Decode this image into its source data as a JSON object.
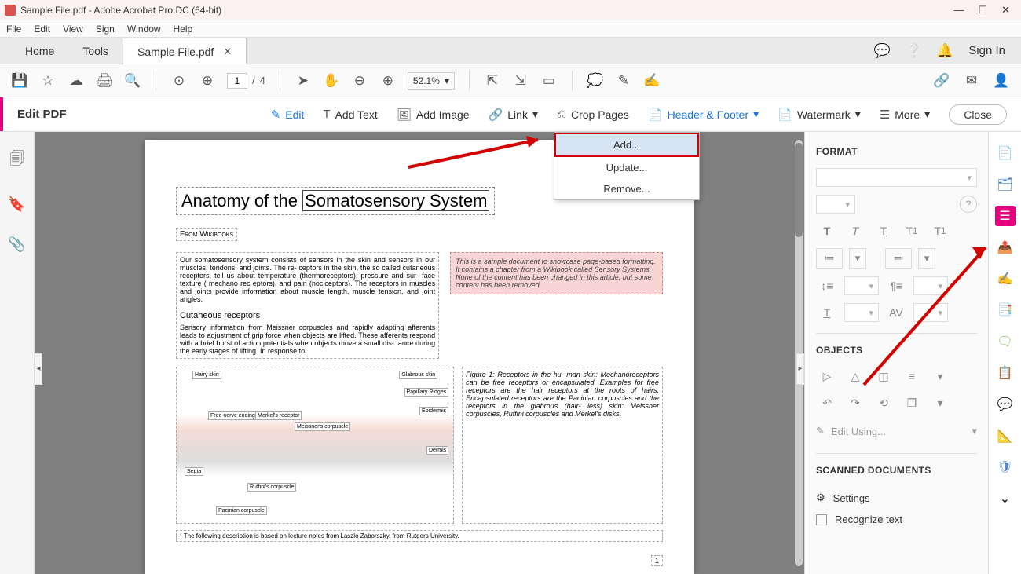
{
  "titlebar": {
    "title": "Sample File.pdf - Adobe Acrobat Pro DC (64-bit)"
  },
  "menubar": {
    "items": [
      "File",
      "Edit",
      "View",
      "Sign",
      "Window",
      "Help"
    ]
  },
  "maintabs": {
    "home": "Home",
    "tools": "Tools",
    "active_tab": "Sample File.pdf",
    "signin": "Sign In"
  },
  "toolbar": {
    "page_current": "1",
    "page_total": "4",
    "zoom": "52.1%"
  },
  "edit_toolbar": {
    "label": "Edit PDF",
    "edit": "Edit",
    "add_text": "Add Text",
    "add_image": "Add Image",
    "link": "Link",
    "crop_pages": "Crop Pages",
    "header_footer": "Header & Footer",
    "watermark": "Watermark",
    "more": "More",
    "close": "Close"
  },
  "dropdown": {
    "add": "Add...",
    "update": "Update...",
    "remove": "Remove..."
  },
  "document": {
    "title_prefix": "Anatomy of the ",
    "title_selected": "Somatosensory System",
    "from": "From Wikibooks",
    "body1": "Our somatosensory system consists of sensors in the skin and sensors in our muscles, tendons, and joints. The re- ceptors in the skin, the so called cutaneous receptors, tell us about temperature (thermoreceptors), pressure and sur- face texture ( mechano rec eptors), and pain (nociceptors). The receptors in muscles and joints provide information about muscle length, muscle tension, and joint angles.",
    "pinkbox": "This is a sample document to showcase page-based formatting. It contains a chapter from a Wikibook called Sensory Systems. None of the content has been changed in this article, but some content has been removed.",
    "subhead": "Cutaneous receptors",
    "body2": "Sensory information from Meissner corpuscles and rapidly adapting afferents leads to adjustment of grip force when objects are lifted. These afferents respond with a brief burst of action potentials when objects move a small dis- tance during the early stages of lifting. In response to",
    "fig_caption": "Figure 1: Receptors in the hu- man skin: Mechanoreceptors can be free receptors or encapsulated. Examples for free receptors are the hair receptors at the roots of hairs. Encapsulated receptors are the Pacinian corpuscles and the receptors in the glabrous (hair- less) skin: Meissner corpuscles, Ruffini corpuscles and Merkel's disks.",
    "footnote": "¹ The following description is based on lecture notes from Laszlo Zaborszky, from Rutgers University.",
    "page_number": "1",
    "fig_labels": {
      "hairy": "Hairy skin",
      "glabrous": "Glabrous skin",
      "papillary": "Papillary Ridges",
      "epidermis": "Epidermis",
      "dermis": "Dermis",
      "free": "Free nerve ending",
      "merkel": "Merkel's receptor",
      "meissner": "Meissner's corpuscle",
      "ruffini": "Ruffini's corpuscle",
      "pacinian": "Pacinian corpuscle",
      "septa": "Septa"
    }
  },
  "format_panel": {
    "heading": "FORMAT",
    "objects_heading": "OBJECTS",
    "edit_using": "Edit Using...",
    "scanned_heading": "SCANNED DOCUMENTS",
    "settings": "Settings",
    "recognize": "Recognize text"
  }
}
